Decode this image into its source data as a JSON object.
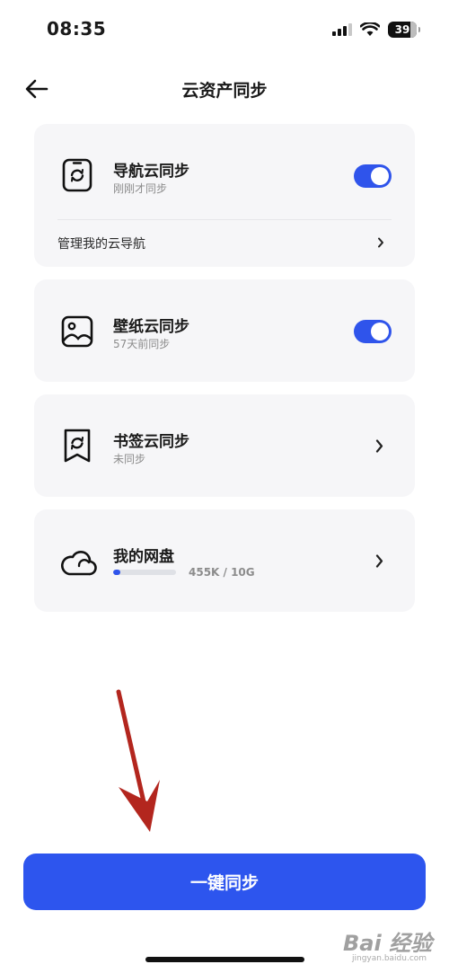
{
  "status_bar": {
    "time": "08:35",
    "battery": "39",
    "icons": [
      "signal-icon",
      "wifi-icon",
      "battery-icon"
    ]
  },
  "header": {
    "title": "云资产同步",
    "back_icon": "arrow-left-icon"
  },
  "cards": {
    "nav_sync": {
      "title": "导航云同步",
      "subtitle": "刚刚才同步",
      "enabled": true,
      "manage_label": "管理我的云导航",
      "icon": "phone-sync-icon"
    },
    "wallpaper_sync": {
      "title": "壁纸云同步",
      "subtitle": "57天前同步",
      "enabled": true,
      "icon": "image-icon"
    },
    "bookmark_sync": {
      "title": "书签云同步",
      "subtitle": "未同步",
      "icon": "bookmark-sync-icon"
    },
    "my_disk": {
      "title": "我的网盘",
      "usage": "455K / 10G",
      "usage_fraction": 0.12,
      "icon": "cloud-icon"
    }
  },
  "sync_all_button": {
    "label": "一键同步"
  },
  "watermark": {
    "logo": "Bai 经验",
    "url": "jingyan.baidu.com"
  },
  "colors": {
    "accent": "#2d55ee",
    "card_bg": "#f6f6f8",
    "annotation_arrow": "#b3261e"
  }
}
